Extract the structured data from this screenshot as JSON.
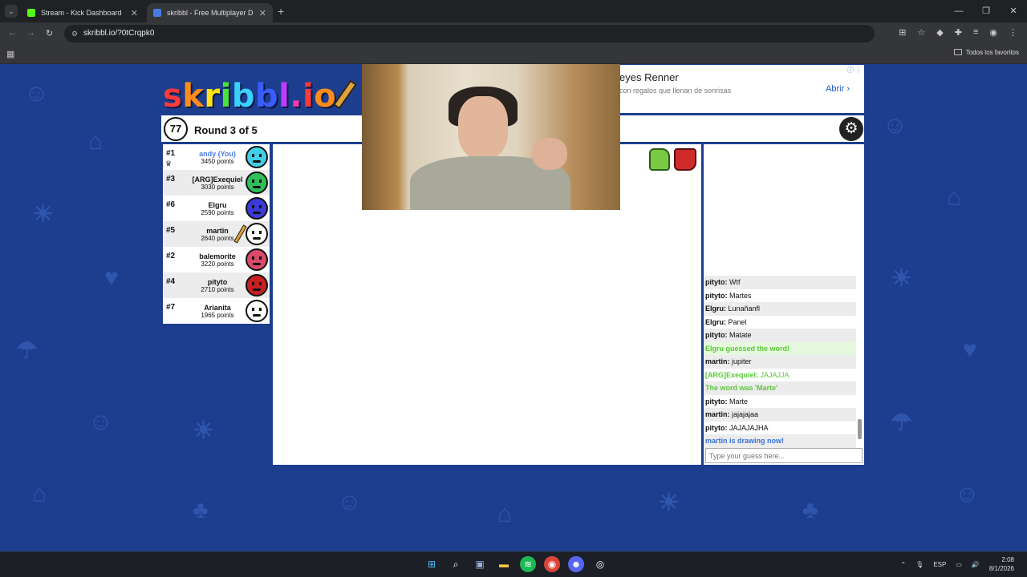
{
  "browser": {
    "tabs": [
      {
        "label": "Stream - Kick Dashboard",
        "favicon_color": "#53fc18"
      },
      {
        "label": "skribbl - Free Multiplayer D",
        "favicon_color": "#4a7de0"
      }
    ],
    "url": "skribbl.io/?0tCrqpk0",
    "bookmarks_folder": "Todos los favoritos"
  },
  "ad": {
    "title": "eyes Renner",
    "subtitle": "con regalos que llenan de sonrisas",
    "cta": "Abrir"
  },
  "game": {
    "logo": "skribbl.io",
    "timer": "77",
    "round_text": "Round 3 of 5",
    "players": [
      {
        "rank": "#1",
        "name": "andy (You)",
        "points": "3450 points",
        "you": true,
        "avatar_color": "#3fd0e8",
        "crown": true
      },
      {
        "rank": "#3",
        "name": "[ARG]Exequiel",
        "points": "3030 points",
        "you": false,
        "avatar_color": "#2fc05a"
      },
      {
        "rank": "#6",
        "name": "Elgru",
        "points": "2590 points",
        "you": false,
        "avatar_color": "#3a3ad8"
      },
      {
        "rank": "#5",
        "name": "martin",
        "points": "2640 points",
        "you": false,
        "avatar_color": "#ffffff",
        "drawing": true
      },
      {
        "rank": "#2",
        "name": "balemorite",
        "points": "3220 points",
        "you": false,
        "avatar_color": "#d94a6a"
      },
      {
        "rank": "#4",
        "name": "pityto",
        "points": "2710 points",
        "you": false,
        "avatar_color": "#c82020"
      },
      {
        "rank": "#7",
        "name": "Arianita",
        "points": "1965 points",
        "you": false,
        "avatar_color": "#ffffff"
      }
    ]
  },
  "chat": {
    "messages": [
      {
        "who": "pityto:",
        "text": "Wtf",
        "type": "normal"
      },
      {
        "who": "pityto:",
        "text": "Martes",
        "type": "normal"
      },
      {
        "who": "Elgru:",
        "text": "Lunañanfl",
        "type": "normal"
      },
      {
        "who": "Elgru:",
        "text": "Panel",
        "type": "normal"
      },
      {
        "who": "pityto:",
        "text": "Matate",
        "type": "normal"
      },
      {
        "who": "",
        "text": "Elgru guessed the word!",
        "type": "guessed"
      },
      {
        "who": "martin:",
        "text": "jupiter",
        "type": "normal"
      },
      {
        "who": "[ARG]Exequiel:",
        "text": "JAJAJJA",
        "type": "green-user"
      },
      {
        "who": "",
        "text": "The word was 'Marte'",
        "type": "system-green"
      },
      {
        "who": "pityto:",
        "text": "Marte",
        "type": "normal"
      },
      {
        "who": "martin:",
        "text": "jajajajaa",
        "type": "normal"
      },
      {
        "who": "pityto:",
        "text": "JAJAJAJHA",
        "type": "normal"
      },
      {
        "who": "",
        "text": "martin is drawing now!",
        "type": "system-blue"
      }
    ],
    "input_placeholder": "Type your guess here..."
  },
  "taskbar": {
    "lang": "ESP",
    "time": "2:08",
    "date": "8/1/2026"
  }
}
